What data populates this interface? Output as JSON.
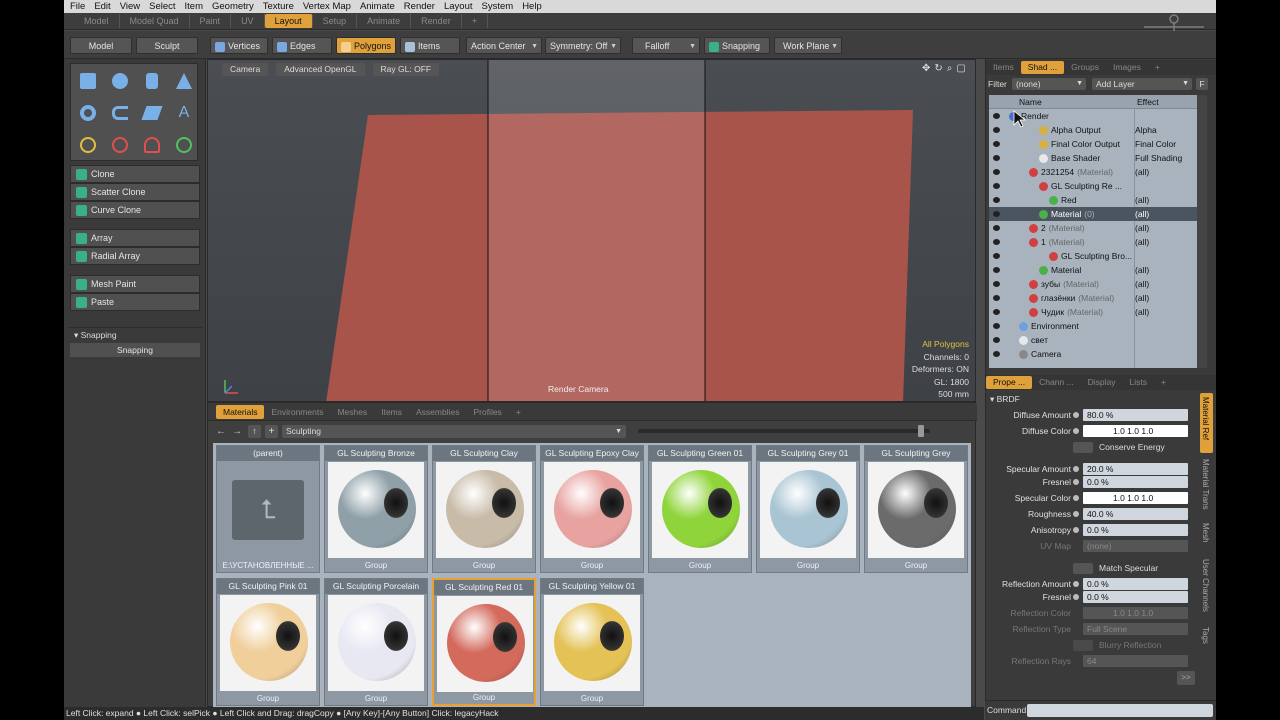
{
  "menubar": [
    "File",
    "Edit",
    "View",
    "Select",
    "Item",
    "Geometry",
    "Texture",
    "Vertex Map",
    "Animate",
    "Render",
    "Layout",
    "System",
    "Help"
  ],
  "layout_tabs": [
    "Model",
    "Model Quad",
    "Paint",
    "UV",
    "Layout",
    "Setup",
    "Animate",
    "Render",
    "+"
  ],
  "toolbar": {
    "model": "Model",
    "sculpt": "Sculpt",
    "vertices": "Vertices",
    "edges": "Edges",
    "polygons": "Polygons",
    "items": "Items",
    "action_center": "Action Center",
    "symmetry": "Symmetry: Off",
    "falloff": "Falloff",
    "snapping": "Snapping",
    "work_plane": "Work Plane"
  },
  "left": {
    "clone": "Clone",
    "scatter_clone": "Scatter Clone",
    "curve_clone": "Curve Clone",
    "array": "Array",
    "radial_array": "Radial Array",
    "mesh_paint": "Mesh Paint",
    "paste": "Paste",
    "snapping_header": "Snapping",
    "snapping_btn": "Snapping"
  },
  "viewport": {
    "camera": "Camera",
    "gl": "Advanced OpenGL",
    "raygl": "Ray GL: OFF",
    "render_camera": "Render Camera",
    "info": [
      "All Polygons",
      "Channels: 0",
      "Deformers: ON",
      "GL: 1800",
      "500 mm"
    ],
    "poly_color": "#a8544b"
  },
  "browser": {
    "tabs": [
      "Materials",
      "Environments",
      "Meshes",
      "Items",
      "Assemblies",
      "Profiles",
      "+"
    ],
    "path": "Sculpting",
    "thumbs": [
      {
        "title": "(parent)",
        "tag": "E:\\УСТАНОВЛЕННЫЕ ...",
        "kind": "folder"
      },
      {
        "title": "GL Sculpting Bronze",
        "tag": "Group",
        "color": "#8fa0a8"
      },
      {
        "title": "GL Sculpting Clay",
        "tag": "Group",
        "color": "#c8bba8"
      },
      {
        "title": "GL Sculpting Epoxy Clay",
        "tag": "Group",
        "color": "#e8a3a0"
      },
      {
        "title": "GL Sculpting Green 01",
        "tag": "Group",
        "color": "#8fd43a"
      },
      {
        "title": "GL Sculpting Grey 01",
        "tag": "Group",
        "color": "#a9c4d3"
      },
      {
        "title": "GL Sculpting Grey",
        "tag": "Group",
        "color": "#6b6b6b"
      },
      {
        "title": "GL Sculpting Pink 01",
        "tag": "Group",
        "color": "#f0cf9b"
      },
      {
        "title": "GL Sculpting Porcelain",
        "tag": "Group",
        "color": "#e8e8f3"
      },
      {
        "title": "GL Sculpting Red 01",
        "tag": "Group",
        "color": "#d36a5c"
      },
      {
        "title": "GL Sculpting Yellow 01",
        "tag": "Group",
        "color": "#e4c255"
      }
    ]
  },
  "right": {
    "tabs": [
      "Items",
      "Shad ...",
      "Groups",
      "Images",
      "+"
    ],
    "filter_label": "Filter",
    "filter_value": "(none)",
    "add_layer": "Add Layer",
    "f": "F",
    "col_name": "Name",
    "col_effect": "Effect",
    "tree": [
      {
        "name": "Render",
        "effect": "",
        "indent": 20,
        "icon": "#4b6fd0"
      },
      {
        "name": "Alpha Output",
        "effect": "Alpha",
        "indent": 50,
        "icon": "#d8b040"
      },
      {
        "name": "Final Color Output",
        "effect": "Final Color",
        "indent": 50,
        "icon": "#d8b040"
      },
      {
        "name": "Base Shader",
        "effect": "Full Shading",
        "indent": 50,
        "icon": "#e8e8e8"
      },
      {
        "name": "2321254",
        "suffix": "(Material)",
        "effect": "(all)",
        "indent": 40,
        "icon": "#d04040"
      },
      {
        "name": "GL Sculpting Re ...",
        "effect": "",
        "indent": 50,
        "icon": "#d04040"
      },
      {
        "name": "Red",
        "effect": "(all)",
        "indent": 60,
        "icon": "#4ab04a"
      },
      {
        "name": "Material",
        "suffix": "(0)",
        "effect": "(all)",
        "indent": 50,
        "icon": "#4ab04a",
        "sel": true
      },
      {
        "name": "2",
        "suffix": "(Material)",
        "effect": "(all)",
        "indent": 40,
        "icon": "#d04040"
      },
      {
        "name": "1",
        "suffix": "(Material)",
        "effect": "(all)",
        "indent": 40,
        "icon": "#d04040"
      },
      {
        "name": "GL Sculpting Bro...",
        "effect": "",
        "indent": 60,
        "icon": "#d04040"
      },
      {
        "name": "Material",
        "effect": "(all)",
        "indent": 50,
        "icon": "#4ab04a"
      },
      {
        "name": "зубы",
        "suffix": "(Material)",
        "effect": "(all)",
        "indent": 40,
        "icon": "#d04040"
      },
      {
        "name": "глазёнки",
        "suffix": "(Material)",
        "effect": "(all)",
        "indent": 40,
        "icon": "#d04040"
      },
      {
        "name": "Чудик",
        "suffix": "(Material)",
        "effect": "(all)",
        "indent": 40,
        "icon": "#d04040"
      },
      {
        "name": "Environment",
        "effect": "",
        "indent": 30,
        "icon": "#6ea0e0"
      },
      {
        "name": "свет",
        "effect": "",
        "indent": 30,
        "icon": "#e8e8e8"
      },
      {
        "name": "Camera",
        "effect": "",
        "indent": 30,
        "icon": "#888"
      }
    ],
    "prop_tabs": [
      "Prope ...",
      "Chann ...",
      "Display",
      "Lists",
      "+"
    ],
    "brdf": "BRDF",
    "side_tabs": [
      "Material Ref",
      "Material Trans",
      "Mesh",
      "User Channels",
      "Tags"
    ],
    "props": {
      "diffuse_amount": {
        "label": "Diffuse Amount",
        "value": "80.0 %"
      },
      "diffuse_color": {
        "label": "Diffuse Color",
        "value": "1.0    1.0    1.0"
      },
      "conserve_energy": "Conserve Energy",
      "specular_amount": {
        "label": "Specular Amount",
        "value": "20.0 %"
      },
      "fresnel": {
        "label": "Fresnel",
        "value": "0.0 %"
      },
      "specular_color": {
        "label": "Specular Color",
        "value": "1.0    1.0    1.0"
      },
      "roughness": {
        "label": "Roughness",
        "value": "40.0 %"
      },
      "anisotropy": {
        "label": "Anisotropy",
        "value": "0.0 %"
      },
      "uv_map": {
        "label": "UV Map",
        "value": "(none)"
      },
      "match_specular": "Match Specular",
      "reflection_amount": {
        "label": "Reflection Amount",
        "value": "0.0 %"
      },
      "fresnel2": {
        "label": "Fresnel",
        "value": "0.0 %"
      },
      "reflection_color": {
        "label": "Reflection Color",
        "value": "1.0    1.0    1.0"
      },
      "reflection_type": {
        "label": "Reflection Type",
        "value": "Full Scene"
      },
      "blurry_reflection": "Blurry Reflection",
      "reflection_rays": {
        "label": "Reflection Rays",
        "value": "64"
      },
      "more": ">>"
    },
    "command_label": "Command"
  },
  "statusbar": "Left Click: expand ● Left Click: selPick ● Left Click and Drag: dragCopy ● [Any Key]-[Any Button] Click: legacyHack"
}
